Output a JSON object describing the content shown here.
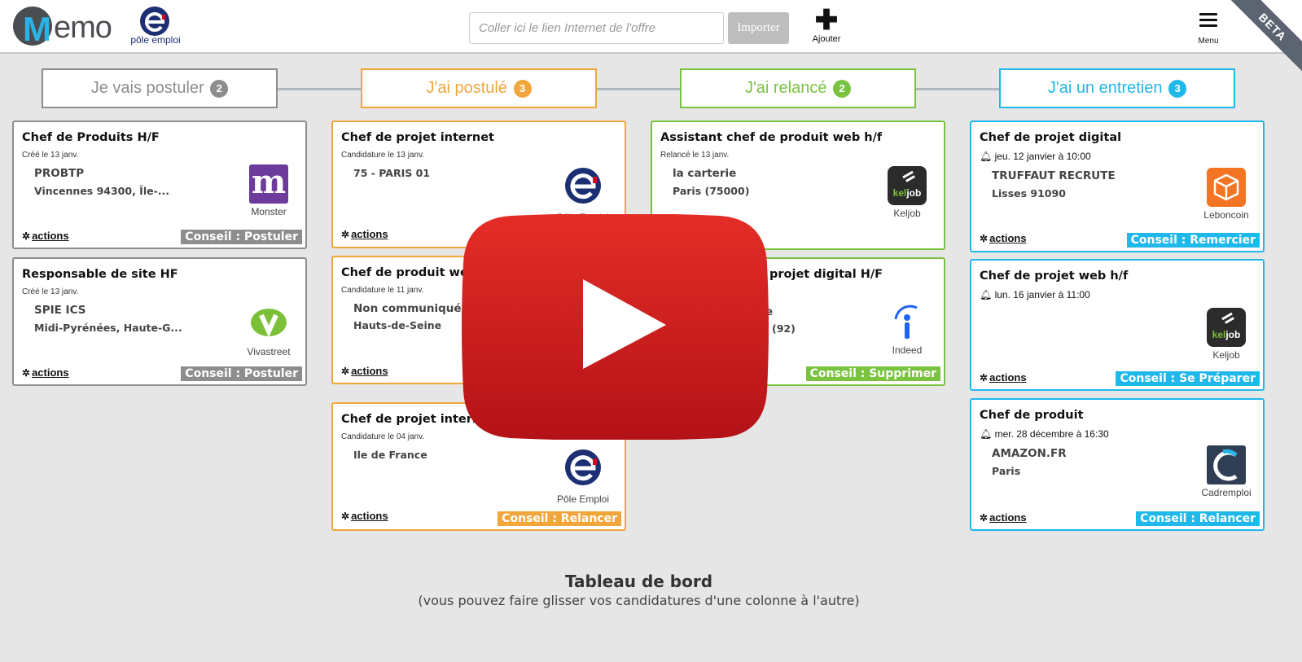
{
  "header": {
    "logo_text": "emo",
    "logo_letter": "M",
    "partner_name": "pôle emploi",
    "search_placeholder": "Coller ici le lien Internet de l'offre",
    "import_label": "Importer",
    "add_label": "Ajouter",
    "menu_label": "Menu",
    "beta_label": "BETA"
  },
  "columns": [
    {
      "title": "Je vais postuler",
      "count": "2",
      "color": "#8d8d8d"
    },
    {
      "title": "J'ai postulé",
      "count": "3",
      "color": "#f0a63a"
    },
    {
      "title": "J'ai relancé",
      "count": "2",
      "color": "#79c340"
    },
    {
      "title": "J'ai un entretien",
      "count": "3",
      "color": "#1fb8ea"
    }
  ],
  "cards": [
    {
      "title": "Chef de Produits H/F",
      "date": "Créé le 13 janv.",
      "company": "PROBTP",
      "location": "Vincennes 94300, Île-...",
      "source": "Monster",
      "source_icon": "monster-logo-icon",
      "actions": "actions",
      "tip": "Conseil : Postuler"
    },
    {
      "title": "Responsable de site HF",
      "date": "Créé le 13 janv.",
      "company": "SPIE ICS",
      "location": "Midi-Pyrénées, Haute-G...",
      "source": "Vivastreet",
      "source_icon": "vivastreet-logo-icon",
      "actions": "actions",
      "tip": "Conseil : Postuler"
    },
    {
      "title": "Chef de projet internet",
      "date": "Candidature le 13 janv.",
      "company": "75 - PARIS 01",
      "location": "",
      "source": "Pôle Emploi",
      "source_icon": "pole-emploi-logo-icon",
      "actions": "actions",
      "tip": ""
    },
    {
      "title": "Chef de produit web",
      "date": "Candidature le 11 janv.",
      "company": "Non communiqué",
      "location": "Hauts-de-Seine",
      "source": "",
      "source_icon": "",
      "actions": "actions",
      "tip": ""
    },
    {
      "title": "Chef de projet interne",
      "date": "Candidature le 04 janv.",
      "company": "Ile de France",
      "location": "",
      "source": "Pôle Emploi",
      "source_icon": "pole-emploi-logo-icon",
      "actions": "actions",
      "tip": "Conseil : Relancer"
    },
    {
      "title": "Assistant chef de produit web h/f",
      "date": "Relancé le 13 janv.",
      "company": "la carterie",
      "location": "Paris (75000)",
      "source": "Keljob",
      "source_icon": "keljob-logo-icon",
      "actions": "actions",
      "tip": ""
    },
    {
      "title": "projet digital H/F",
      "date": "",
      "company": "e",
      "location": "(92)",
      "source": "Indeed",
      "source_icon": "indeed-logo-icon",
      "actions": "",
      "tip": "Conseil : Supprimer"
    },
    {
      "title": "Chef de projet digital",
      "date": "jeu. 12 janvier à 10:00",
      "company": "TRUFFAUT RECRUTE",
      "location": "Lisses 91090",
      "source": "Leboncoin",
      "source_icon": "leboncoin-logo-icon",
      "actions": "actions",
      "tip": "Conseil : Remercier"
    },
    {
      "title": "Chef de projet web h/f",
      "date": "lun. 16 janvier à 11:00",
      "company": "",
      "location": "",
      "source": "Keljob",
      "source_icon": "keljob-logo-icon",
      "actions": "actions",
      "tip": "Conseil : Se Préparer"
    },
    {
      "title": "Chef de produit",
      "date": "mer. 28 décembre à 16:30",
      "company": "AMAZON.FR",
      "location": "Paris",
      "source": "Cadremploi",
      "source_icon": "cadremploi-logo-icon",
      "actions": "actions",
      "tip": "Conseil : Relancer"
    }
  ],
  "tip_colors": {
    "grey": "#8d8d8d",
    "orange": "#f0a63a",
    "green": "#79c340",
    "blue": "#1fb8ea"
  },
  "footer": {
    "title": "Tableau de bord",
    "subtitle": "(vous pouvez faire glisser vos candidatures d'une colonne à l'autre)"
  },
  "overlay": {
    "icon": "youtube-play-icon",
    "color": "#d92323"
  }
}
